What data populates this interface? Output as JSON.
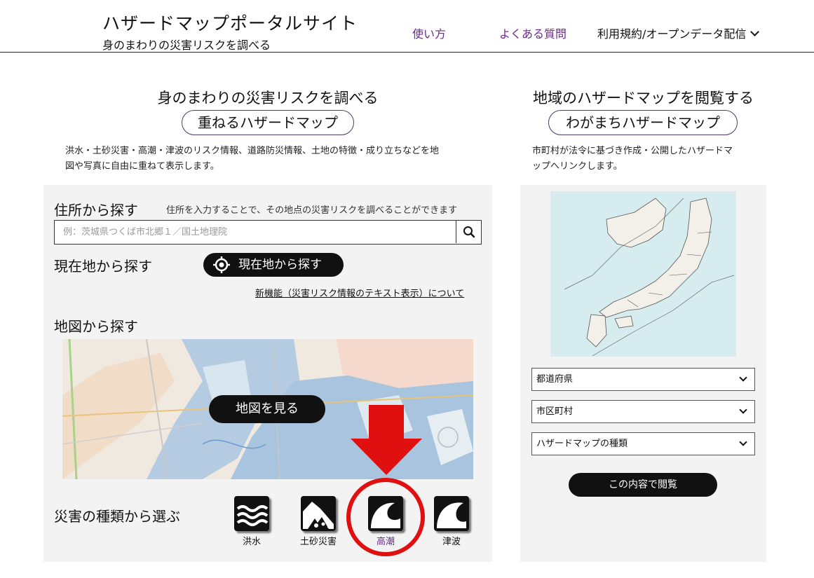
{
  "header": {
    "title": "ハザードマップポータルサイト",
    "subtitle": "身のまわりの災害リスクを調べる",
    "nav": {
      "usage": "使い方",
      "faq": "よくある質問",
      "terms": "利用規約/オープンデータ配信"
    }
  },
  "left": {
    "heading": "身のまわりの災害リスクを調べる",
    "pill": "重ねるハザードマップ",
    "description_line1": "洪水・土砂災害・高潮・津波のリスク情報、道路防災情報、土地の特徴・成り立ちなどを地",
    "description_line2": "図や写真に自由に重ねて表示します。",
    "address": {
      "label": "住所から探す",
      "hint": "住所を入力することで、その地点の災害リスクを調べることができます",
      "placeholder": "例：茨城県つくば市北郷１／国土地理院"
    },
    "current_location": {
      "label": "現在地から探す",
      "button": "現在地から探す"
    },
    "new_feature_link": "新機能（災害リスク情報のテキスト表示）について",
    "map": {
      "label": "地図から探す",
      "button": "地図を見る"
    },
    "hazard_types": {
      "label": "災害の種類から選ぶ",
      "items": [
        {
          "label": "洪水",
          "icon": "flood-icon"
        },
        {
          "label": "土砂災害",
          "icon": "landslide-icon"
        },
        {
          "label": "高潮",
          "icon": "storm-surge-icon"
        },
        {
          "label": "津波",
          "icon": "tsunami-icon"
        }
      ]
    }
  },
  "right": {
    "heading": "地域のハザードマップを閲覧する",
    "pill": "わがまちハザードマップ",
    "description_line1": "市町村が法令に基づき作成・公開したハザードマ",
    "description_line2": "ップへリンクします。",
    "selects": {
      "prefecture": "都道府県",
      "municipality": "市区町村",
      "map_type": "ハザードマップの種類"
    },
    "view_button": "この内容で閲覧"
  },
  "colors": {
    "accent": "#6a2a8a",
    "annotation_red": "#e01010",
    "panel_bg": "#f3f3f3"
  }
}
